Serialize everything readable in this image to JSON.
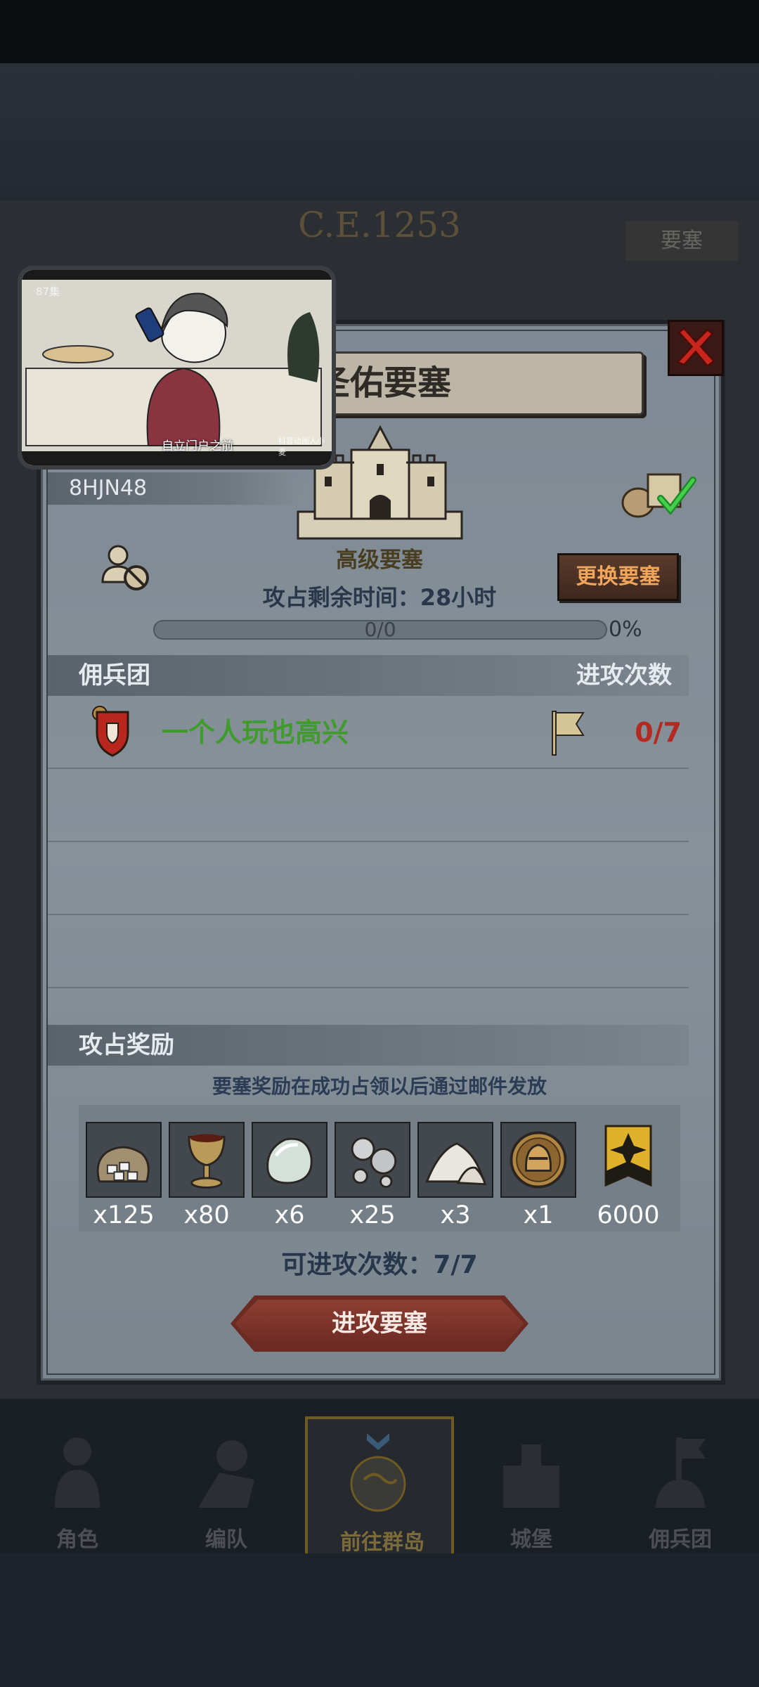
{
  "era": "C.E.1253",
  "background_tag": "要塞",
  "pip": {
    "episode": "87集",
    "caption": "自立门户之前",
    "watermark": "抖音动画人小麦"
  },
  "dialog": {
    "title": "圣佑要塞",
    "fortress_id": "8HJN48",
    "tier": "高级要塞",
    "change_button": "更换要塞",
    "remaining_time": "攻占剩余时间：28小时",
    "progress": {
      "label": "0/0",
      "percent_text": "0%",
      "fraction": 0.0
    },
    "mercenary_section": {
      "title": "佣兵团",
      "right_title": "进攻次数"
    },
    "mercenaries": [
      {
        "name": "一个人玩也高兴",
        "attacks": "0/7"
      }
    ],
    "reward_section": {
      "title": "攻占奖励",
      "note": "要塞奖励在成功占领以后通过邮件发放",
      "items": [
        {
          "icon": "ore-sack-icon",
          "qty": "x125"
        },
        {
          "icon": "goblet-icon",
          "qty": "x80"
        },
        {
          "icon": "moonstone-icon",
          "qty": "x6"
        },
        {
          "icon": "silver-nuggets-icon",
          "qty": "x25"
        },
        {
          "icon": "salt-pile-icon",
          "qty": "x3"
        },
        {
          "icon": "knight-helmet-medal-icon",
          "qty": "x1"
        },
        {
          "icon": "honor-badge-icon",
          "qty": "6000"
        }
      ]
    },
    "available_attacks": "可进攻次数：7/7",
    "attack_button": "进攻要塞"
  },
  "nav": [
    {
      "label": "角色",
      "icon": "character-icon"
    },
    {
      "label": "编队",
      "icon": "formation-icon"
    },
    {
      "label": "前往群岛",
      "icon": "islands-globe-icon",
      "active": true
    },
    {
      "label": "城堡",
      "icon": "castle-icon"
    },
    {
      "label": "佣兵团",
      "icon": "mercenary-icon"
    }
  ],
  "colors": {
    "merc_name": "#3e9b2c",
    "attack_count": "#b22a22",
    "change_button_text": "#f0a55a",
    "attack_button": "#6b2a22"
  }
}
